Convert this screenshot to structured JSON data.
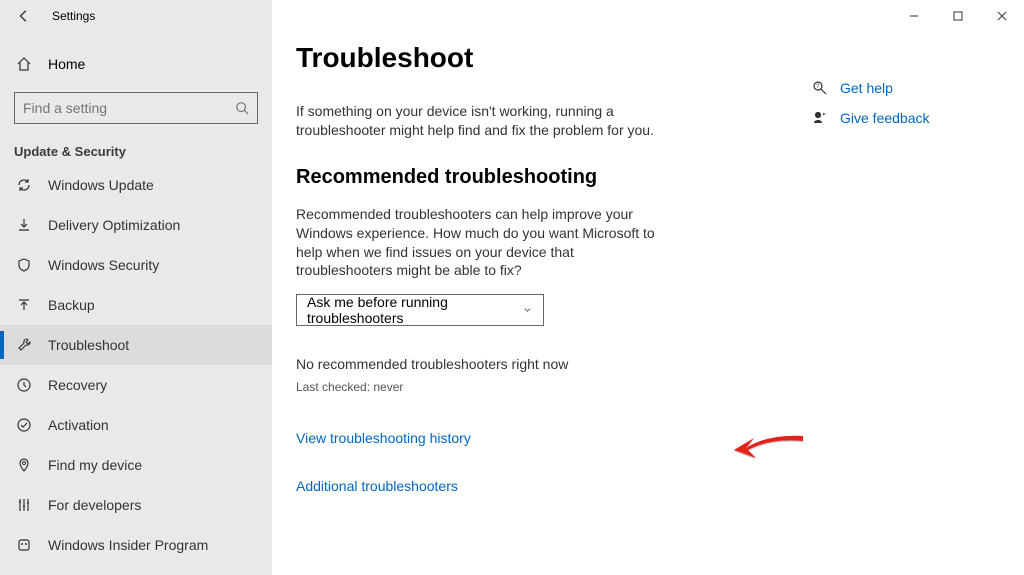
{
  "titlebar": {
    "title": "Settings"
  },
  "home_label": "Home",
  "search": {
    "placeholder": "Find a setting"
  },
  "section": "Update & Security",
  "nav": [
    {
      "id": "windows-update",
      "label": "Windows Update"
    },
    {
      "id": "delivery-optimization",
      "label": "Delivery Optimization"
    },
    {
      "id": "windows-security",
      "label": "Windows Security"
    },
    {
      "id": "backup",
      "label": "Backup"
    },
    {
      "id": "troubleshoot",
      "label": "Troubleshoot",
      "selected": true
    },
    {
      "id": "recovery",
      "label": "Recovery"
    },
    {
      "id": "activation",
      "label": "Activation"
    },
    {
      "id": "find-my-device",
      "label": "Find my device"
    },
    {
      "id": "for-developers",
      "label": "For developers"
    },
    {
      "id": "windows-insider-program",
      "label": "Windows Insider Program"
    }
  ],
  "page": {
    "title": "Troubleshoot",
    "intro": "If something on your device isn't working, running a troubleshooter might help find and fix the problem for you.",
    "recommended_heading": "Recommended troubleshooting",
    "recommended_intro": "Recommended troubleshooters can help improve your Windows experience. How much do you want Microsoft to help when we find issues on your device that troubleshooters might be able to fix?",
    "dropdown_value": "Ask me before running troubleshooters",
    "no_recommended": "No recommended troubleshooters right now",
    "last_checked": "Last checked: never",
    "history_link": "View troubleshooting history",
    "additional_link": "Additional troubleshooters"
  },
  "aside": {
    "get_help": "Get help",
    "give_feedback": "Give feedback"
  }
}
